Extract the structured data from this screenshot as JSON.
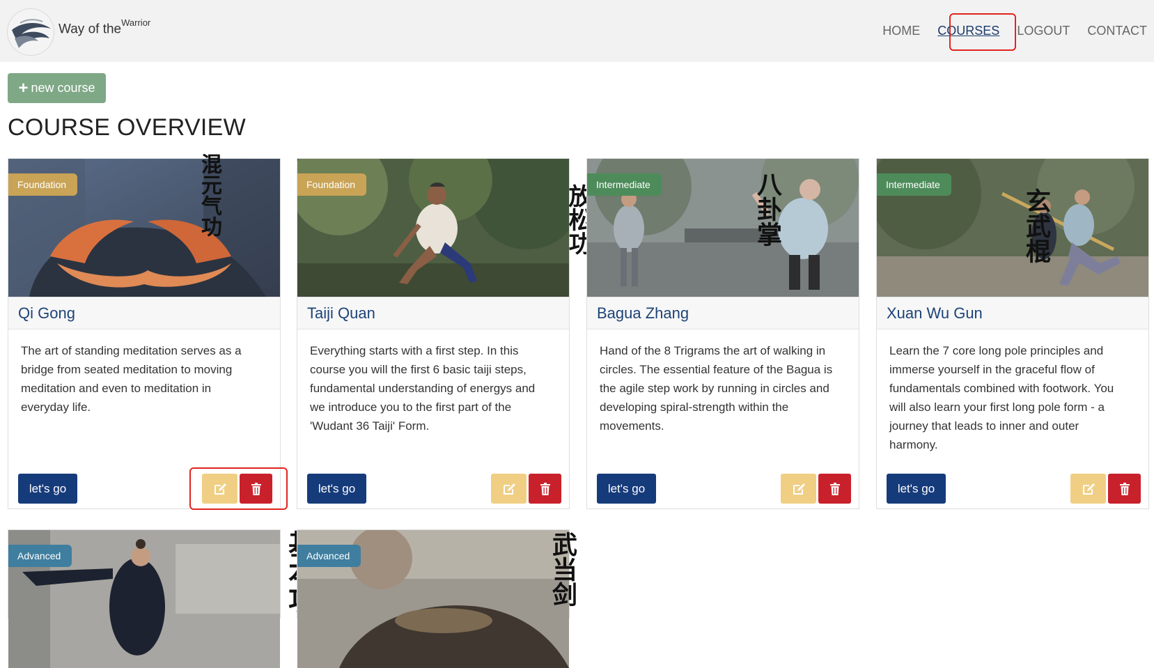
{
  "brand": {
    "name": "Way of the",
    "superscript": "Warrior",
    "logo_icon": "ink-wave-logo"
  },
  "nav": {
    "items": [
      {
        "label": "HOME",
        "active": false
      },
      {
        "label": "COURSES",
        "active": true
      },
      {
        "label": "LOGOUT",
        "active": false
      },
      {
        "label": "CONTACT",
        "active": false
      }
    ]
  },
  "controls": {
    "new_course_label": "new course",
    "new_course_icon": "plus-icon"
  },
  "page": {
    "heading": "COURSE OVERVIEW"
  },
  "colors": {
    "foundation": "#c9a456",
    "intermediate": "#4d8c5a",
    "advanced": "#3f7e9f",
    "go_button": "#163b7b",
    "edit_button": "#f0cf84",
    "delete_button": "#c9212b",
    "new_button": "#7fa886",
    "title_link": "#1d4378"
  },
  "courses": [
    {
      "level": "Foundation",
      "title": "Qi Gong",
      "chinese": "混元气功",
      "description": "The art of standing meditation serves as a bridge from seated meditation to moving meditation and even to meditation in everyday life.",
      "go_label": "let's go",
      "edit_icon": "edit-icon",
      "delete_icon": "trash-icon"
    },
    {
      "level": "Foundation",
      "title": "Taiji Quan",
      "chinese": "放松功",
      "description": "Everything starts with a first step. In this course you will the first 6 basic taiji steps, fundamental understanding of energys and we introduce you to the first part of the 'Wudant 36 Taiji' Form.",
      "go_label": "let's go",
      "edit_icon": "edit-icon",
      "delete_icon": "trash-icon"
    },
    {
      "level": "Intermediate",
      "title": "Bagua Zhang",
      "chinese": "八卦掌",
      "description": "Hand of the 8 Trigrams the art of walking in circles. The essential feature of the Bagua is the agile step work by running in circles and developing spiral-strength within the movements.",
      "go_label": "let's go",
      "edit_icon": "edit-icon",
      "delete_icon": "trash-icon"
    },
    {
      "level": "Intermediate",
      "title": "Xuan Wu Gun",
      "chinese": "玄武棍",
      "description": "Learn the 7 core long pole principles and immerse yourself in the graceful flow of fundamentals combined with footwork. You will also learn your first long pole form - a journey that leads to inner and outer harmony.",
      "go_label": "let's go",
      "edit_icon": "edit-icon",
      "delete_icon": "trash-icon"
    },
    {
      "level": "Advanced",
      "chinese": "基本功"
    },
    {
      "level": "Advanced",
      "chinese": "武当剑"
    }
  ]
}
